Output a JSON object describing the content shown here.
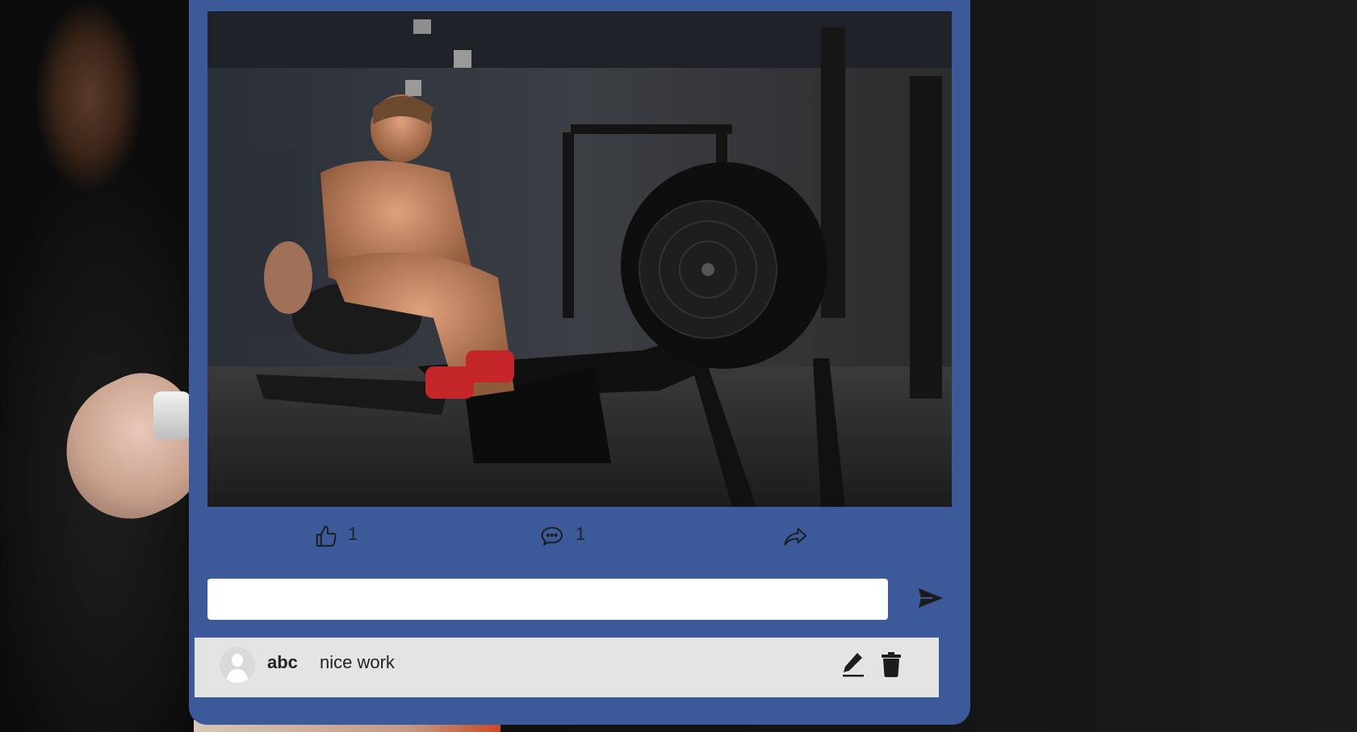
{
  "post": {
    "image_description_icon": "gym-rowing-machine-photo",
    "likes_count": "1",
    "comments_count": "1"
  },
  "actions": {
    "like_icon": "thumbs-up-icon",
    "comment_icon": "chat-bubbles-icon",
    "share_icon": "share-arrow-icon"
  },
  "comment_box": {
    "value": "",
    "placeholder": "",
    "send_icon": "send-icon"
  },
  "comments": [
    {
      "author": "abc",
      "text": "nice work",
      "avatar_icon": "user-avatar-icon",
      "edit_icon": "pencil-icon",
      "delete_icon": "trash-icon"
    }
  ],
  "colors": {
    "card": "#3c5a9a",
    "comment_bg": "#e4e4e4",
    "page_bg": "#111111"
  }
}
